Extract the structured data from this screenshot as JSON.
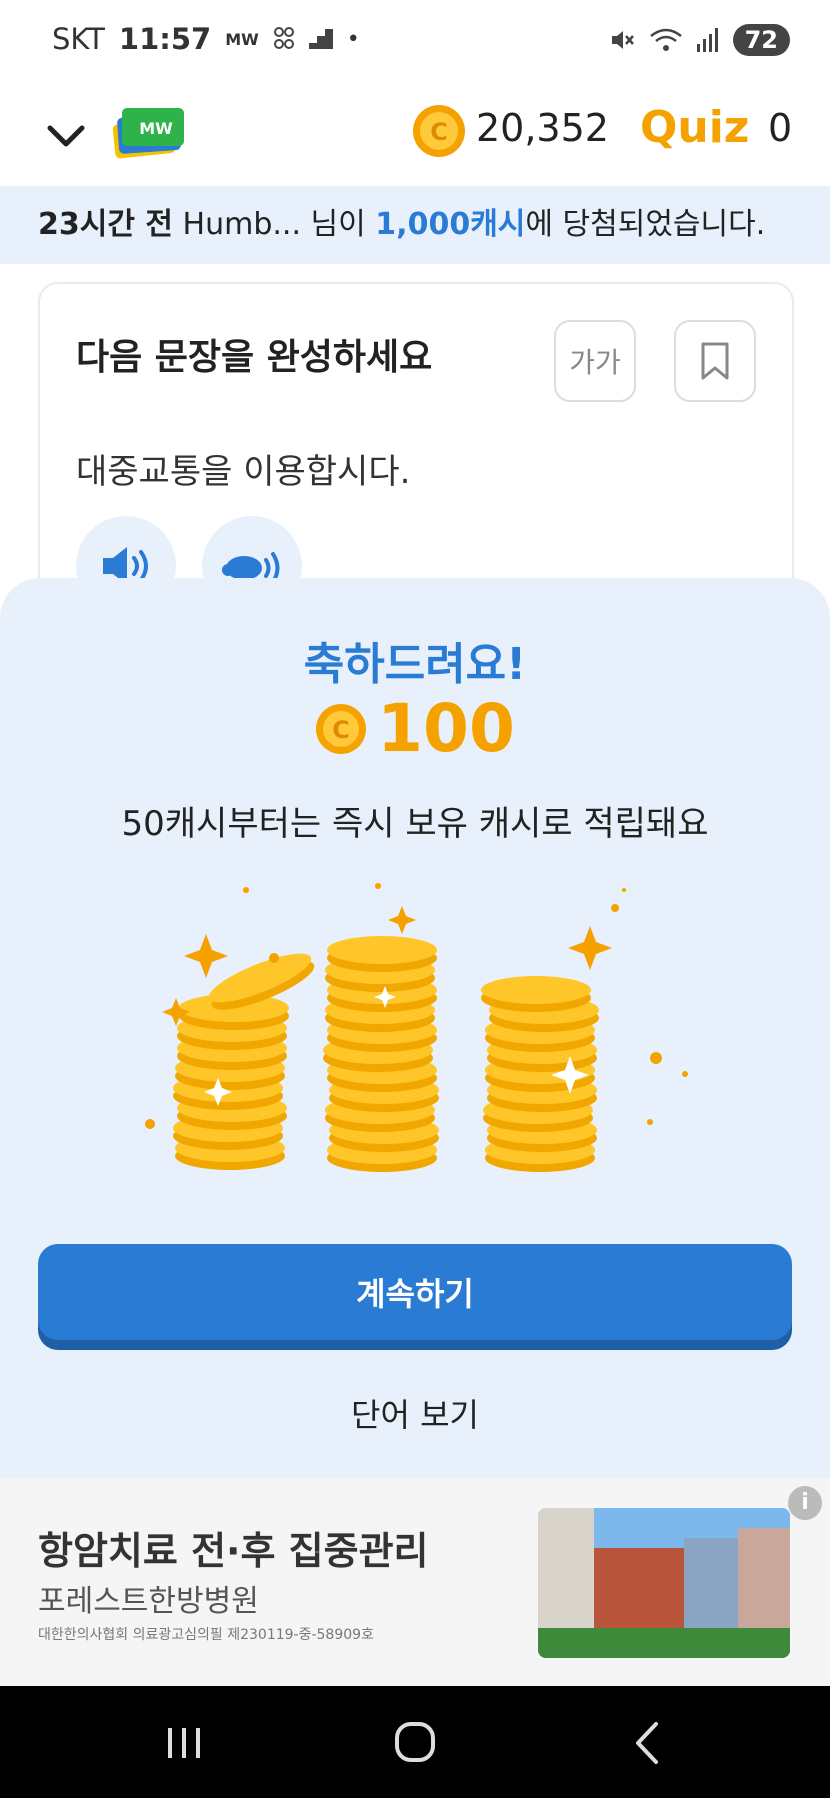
{
  "status_bar": {
    "carrier": "SKT",
    "time": "11:57",
    "mini_label": "MW",
    "battery": "72"
  },
  "header": {
    "logo_text": "MW",
    "cash_amount": "20,352",
    "quiz_label": "Quiz",
    "quiz_count": "0"
  },
  "notice": {
    "time_ago": "23시간 전",
    "user": "Humb...",
    "middle": "님이",
    "amount": "1,000캐시",
    "suffix": "에 당첨되었습니다."
  },
  "card": {
    "title": "다음 문장을 완성하세요",
    "font_size_label": "가가",
    "sentence": "대중교통을 이용합시다."
  },
  "reward_sheet": {
    "congrats": "축하드려요!",
    "amount": "100",
    "description": "50캐시부터는 즉시 보유 캐시로 적립돼요",
    "continue_label": "계속하기",
    "view_words_label": "단어 보기"
  },
  "ad": {
    "title": "항암치료 전·후 집중관리",
    "subtitle": "포레스트한방병원",
    "fine_print": "대한한의사협회 의료광고심의필 제230119-중-58909호",
    "info_label": "i"
  },
  "colors": {
    "accent_blue": "#2a7bd4",
    "coin_gold": "#f5a200",
    "sheet_bg": "#e8f1fb"
  }
}
